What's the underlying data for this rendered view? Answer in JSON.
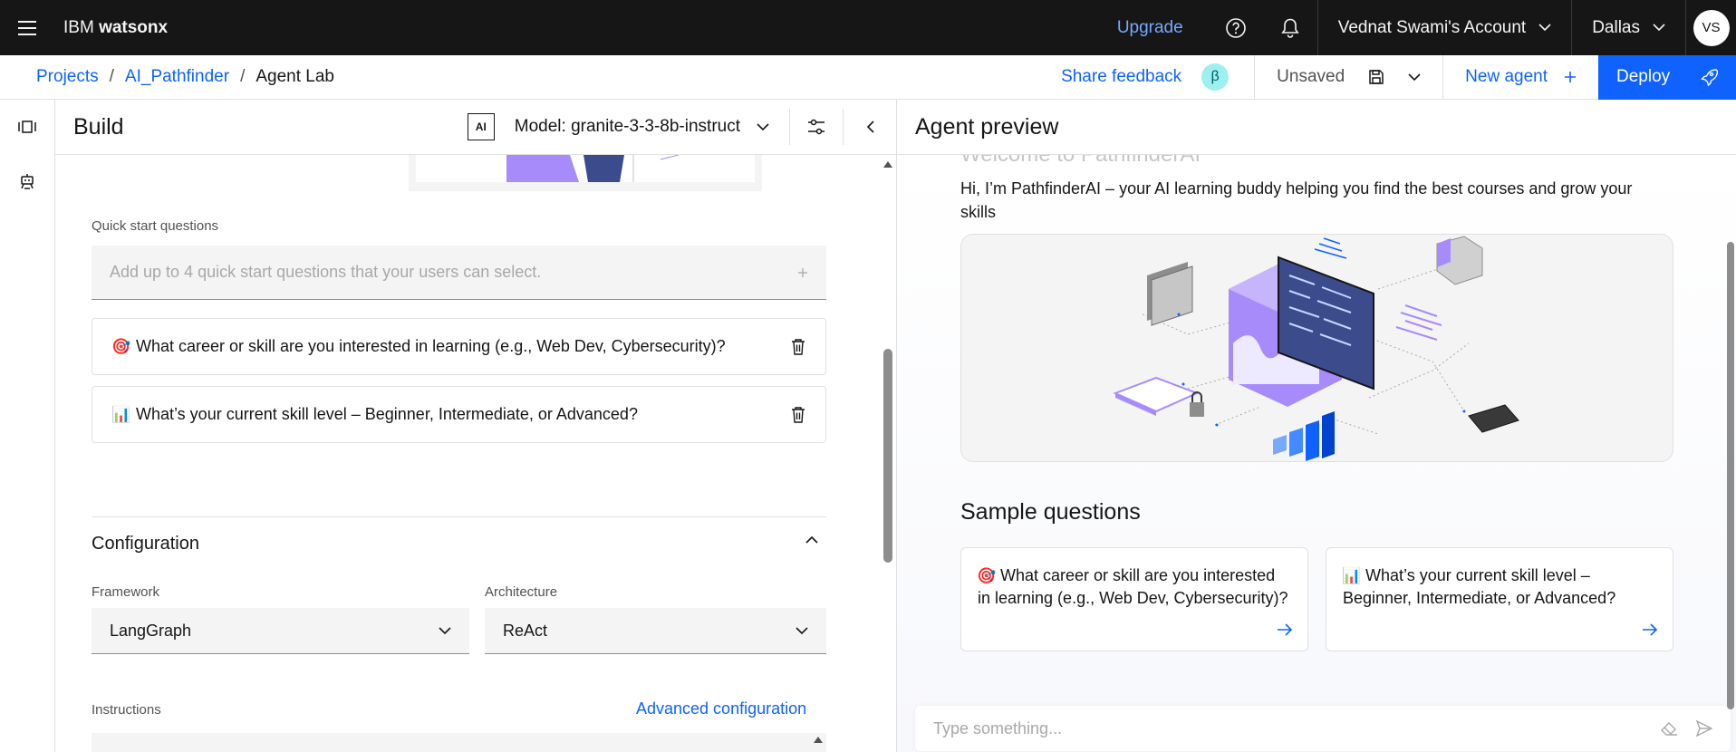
{
  "topbar": {
    "brand_prefix": "IBM",
    "brand_name": "watsonx",
    "upgrade": "Upgrade",
    "account": "Vednat Swami's Account",
    "region": "Dallas",
    "avatar": "VS"
  },
  "breadcrumb": {
    "items": [
      "Projects",
      "AI_Pathfinder",
      "Agent Lab"
    ],
    "separator": "/"
  },
  "actions": {
    "share_feedback": "Share feedback",
    "beta": "β",
    "unsaved": "Unsaved",
    "new_agent": "New agent",
    "deploy": "Deploy"
  },
  "build": {
    "title": "Build",
    "ai_badge": "AI",
    "model": "Model: granite-3-3-8b-instruct",
    "quick_start_label": "Quick start questions",
    "quick_start_placeholder": "Add up to 4 quick start questions that your users can select.",
    "questions": [
      {
        "emoji": "🎯",
        "text": "What career or skill are you interested in learning (e.g., Web Dev, Cybersecurity)?"
      },
      {
        "emoji": "📊",
        "text": "What’s your current skill level – Beginner, Intermediate, or Advanced?"
      }
    ],
    "configuration_title": "Configuration",
    "framework_label": "Framework",
    "framework_value": "LangGraph",
    "architecture_label": "Architecture",
    "architecture_value": "ReAct",
    "instructions_label": "Instructions",
    "advanced_link": "Advanced configuration"
  },
  "preview": {
    "title": "Agent preview",
    "welcome": "Welcome to PathfinderAI",
    "intro": "Hi, I’m PathfinderAI – your AI learning buddy helping you find the best courses and grow your skills",
    "sample_title": "Sample questions",
    "samples": [
      {
        "emoji": "🎯",
        "text": "What career or skill are you interested in learning (e.g., Web Dev, Cybersecurity)?"
      },
      {
        "emoji": "📊",
        "text": "What’s your current skill level – Beginner, Intermediate, or Advanced?"
      }
    ],
    "chat_placeholder": "Type something..."
  },
  "colors": {
    "topbar_bg": "#161616",
    "link_blue": "#0f62fe",
    "upgrade_blue": "#78a9ff",
    "field_bg": "#f4f4f4",
    "beta_bg": "#9ef0f0"
  },
  "icons": [
    "hamburger-icon",
    "help-icon",
    "notification-icon",
    "chevron-down-icon",
    "save-icon",
    "plus-icon",
    "rocket-icon",
    "chevron-left-icon",
    "sliders-icon",
    "trash-icon",
    "chevron-up-icon",
    "arrow-right-icon",
    "eraser-icon",
    "send-icon"
  ]
}
